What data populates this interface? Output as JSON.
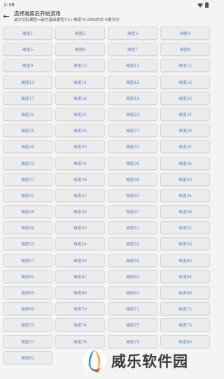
{
  "status_bar": {
    "time": "2:38"
  },
  "header": {
    "title": "选择难度后开始游戏",
    "subtitle": "敌方实际属性=敌方基础属性*(1+难度*0.005)的关卡数次方"
  },
  "levels": [
    "难度1",
    "难度2",
    "难度3",
    "难度4",
    "难度5",
    "难度6",
    "难度7",
    "难度8",
    "难度9",
    "难度10",
    "难度11",
    "难度12",
    "难度13",
    "难度14",
    "难度15",
    "难度16",
    "难度17",
    "难度18",
    "难度19",
    "难度20",
    "难度21",
    "难度22",
    "难度23",
    "难度24",
    "难度25",
    "难度26",
    "难度27",
    "难度28",
    "难度29",
    "难度30",
    "难度31",
    "难度32",
    "难度33",
    "难度34",
    "难度35",
    "难度36",
    "难度37",
    "难度38",
    "难度39",
    "难度40",
    "难度41",
    "难度42",
    "难度43",
    "难度44",
    "难度45",
    "难度46",
    "难度47",
    "难度48",
    "难度49",
    "难度50",
    "难度51",
    "难度52",
    "难度53",
    "难度54",
    "难度55",
    "难度56",
    "难度57",
    "难度58",
    "难度59",
    "难度60",
    "难度61",
    "难度62",
    "难度63",
    "难度64",
    "难度65",
    "难度66",
    "难度67",
    "难度68",
    "难度69",
    "难度70",
    "难度71",
    "难度72",
    "难度73",
    "难度74",
    "难度75",
    "难度76",
    "难度77",
    "难度78",
    "难度79",
    "难度80",
    "难度81"
  ],
  "watermark": {
    "text": "威乐软件园"
  },
  "colors": {
    "level_text": "#5a88c8",
    "button_bg": "#ececec"
  }
}
